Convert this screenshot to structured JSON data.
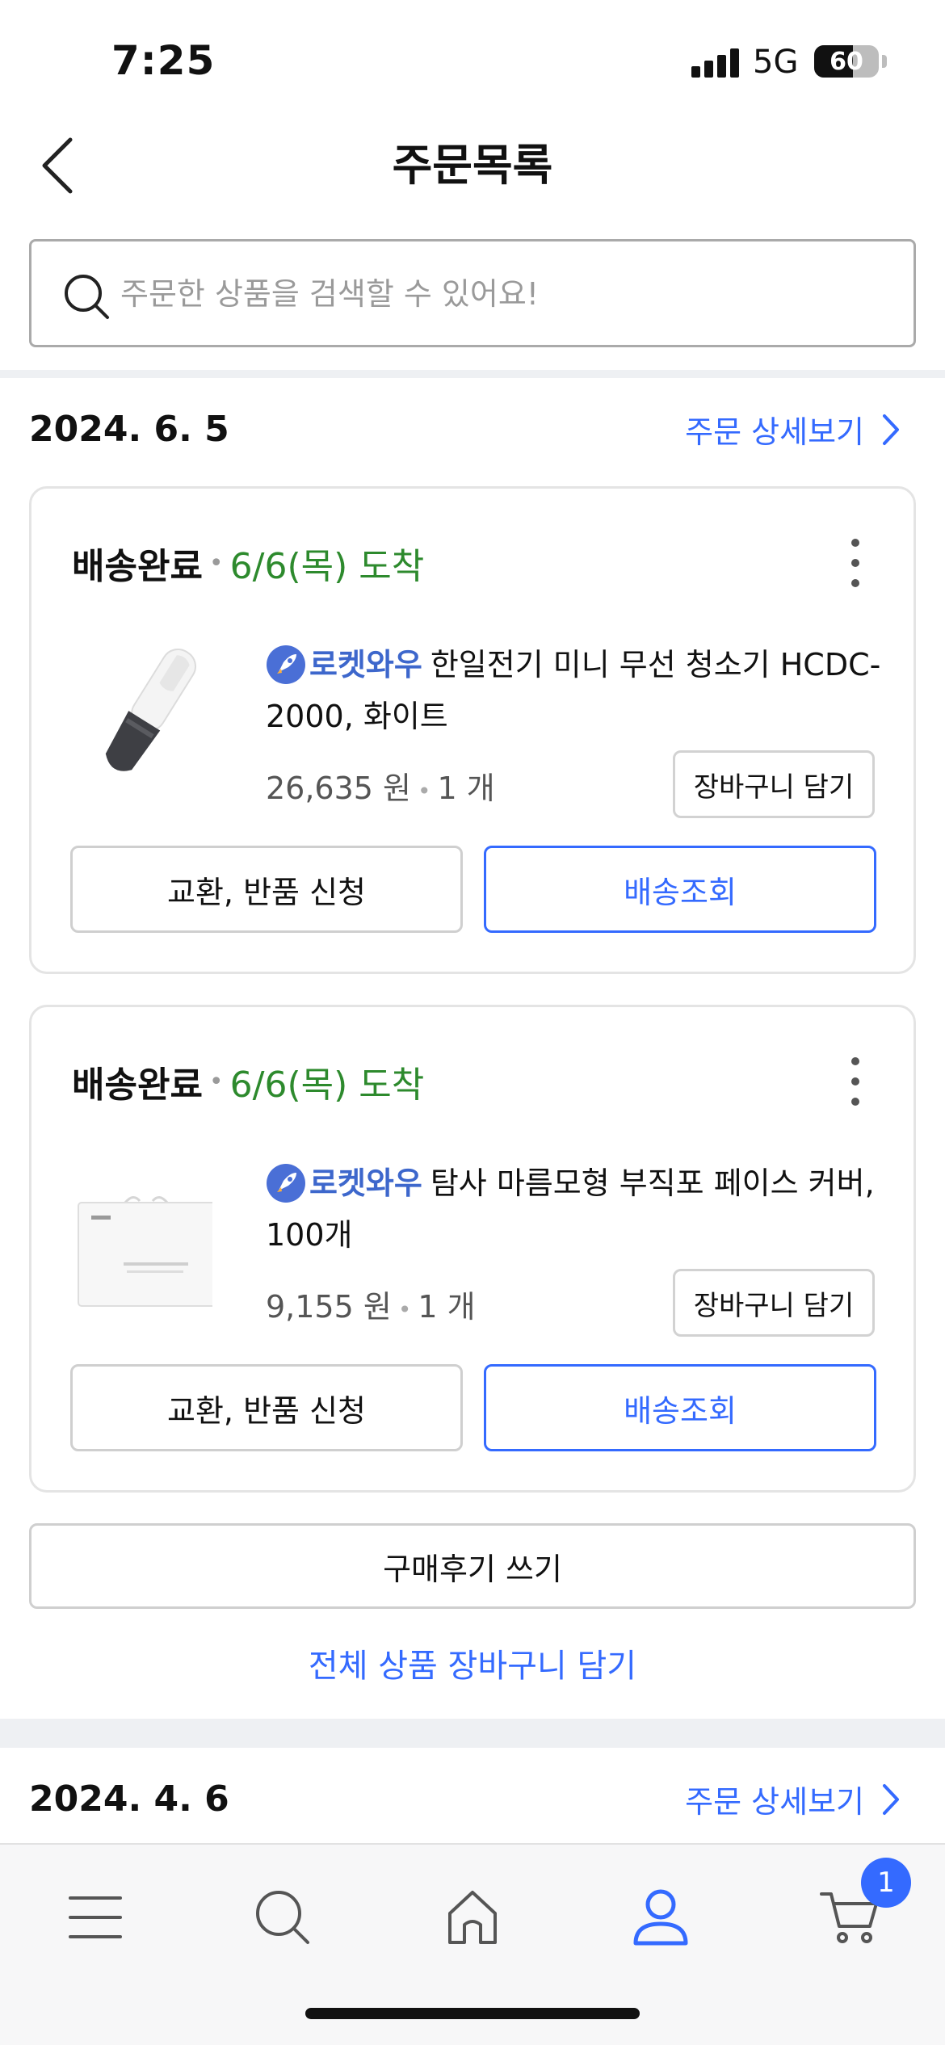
{
  "status_bar": {
    "time": "7:25",
    "network": "5G",
    "battery": "60",
    "battery_level": 0.6
  },
  "header": {
    "title": "주문목록"
  },
  "search": {
    "placeholder": "주문한 상품을 검색할 수 있어요!"
  },
  "orders": [
    {
      "date": "2024. 6. 5",
      "detail_link": "주문 상세보기",
      "items": [
        {
          "status": "배송완료",
          "arrival": "6/6(목) 도착",
          "badge": "로켓와우",
          "name": "한일전기 미니 무선 청소기 HCDC-2000, 화이트",
          "price": "26,635 원",
          "quantity": "1 개",
          "cart_button": "장바구니 담기",
          "exchange_button": "교환, 반품 신청",
          "track_button": "배송조회"
        },
        {
          "status": "배송완료",
          "arrival": "6/6(목) 도착",
          "badge": "로켓와우",
          "name": "탐사 마름모형 부직포 페이스 커버, 100개",
          "price": "9,155 원",
          "quantity": "1 개",
          "cart_button": "장바구니 담기",
          "exchange_button": "교환, 반품 신청",
          "track_button": "배송조회"
        }
      ],
      "review_button": "구매후기 쓰기",
      "cart_all_link": "전체 상품 장바구니 담기"
    },
    {
      "date": "2024. 4. 6",
      "detail_link": "주문 상세보기"
    }
  ],
  "tab_bar": {
    "tabs": [
      "menu-icon",
      "search-icon",
      "home-icon",
      "my-account-icon",
      "cart-icon"
    ],
    "active": "my-account-icon",
    "cart_badge": "1"
  },
  "colors": {
    "accent": "#346aff",
    "arrival_green": "#2d8a2d",
    "rocket_blue": "#3d67cc"
  }
}
